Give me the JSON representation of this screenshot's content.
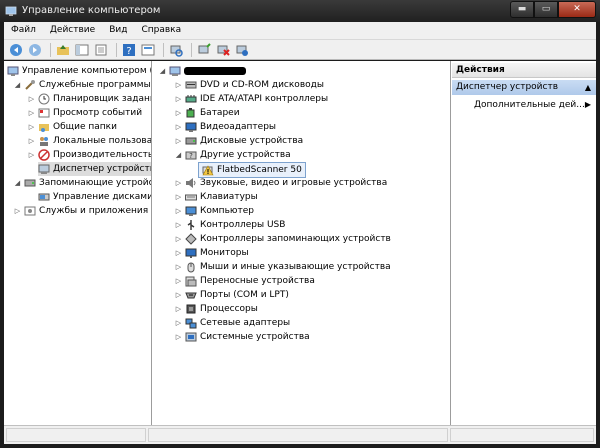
{
  "window": {
    "title": "Управление компьютером",
    "controls": {
      "minimize": "▬",
      "maximize": "▭",
      "close": "✕"
    }
  },
  "menu": [
    "Файл",
    "Действие",
    "Вид",
    "Справка"
  ],
  "toolbar_icons": [
    "back-icon",
    "forward-icon",
    "up-folder-icon",
    "show-hide-tree-icon",
    "export-list-icon",
    "help-icon",
    "properties-icon",
    "scan-hardware-icon",
    "update-driver-icon",
    "disable-device-icon",
    "uninstall-device-icon"
  ],
  "left_tree": [
    {
      "label": "Управление компьютером (л",
      "toggle": "",
      "icon": "computer-management-icon"
    },
    {
      "label": "Служебные программы",
      "toggle": "◢",
      "icon": "tools-icon"
    },
    {
      "label": "Планировщик заданий",
      "toggle": "▷",
      "icon": "clock-icon"
    },
    {
      "label": "Просмотр событий",
      "toggle": "▷",
      "icon": "event-viewer-icon"
    },
    {
      "label": "Общие папки",
      "toggle": "▷",
      "icon": "shared-folder-icon"
    },
    {
      "label": "Локальные пользовате",
      "toggle": "▷",
      "icon": "users-icon"
    },
    {
      "label": "Производительность",
      "toggle": "▷",
      "icon": "performance-icon"
    },
    {
      "label": "Диспетчер устройств",
      "toggle": "",
      "icon": "device-manager-icon"
    },
    {
      "label": "Запоминающие устройств",
      "toggle": "◢",
      "icon": "storage-icon"
    },
    {
      "label": "Управление дисками",
      "toggle": "",
      "icon": "disk-management-icon"
    },
    {
      "label": "Службы и приложения",
      "toggle": "▷",
      "icon": "services-icon"
    }
  ],
  "device_tree": {
    "root_toggle": "◢",
    "children": [
      {
        "label": "DVD и CD-ROM дисководы",
        "toggle": "▷",
        "icon": "dvd-icon"
      },
      {
        "label": "IDE ATA/ATAPI контроллеры",
        "toggle": "▷",
        "icon": "ide-controller-icon"
      },
      {
        "label": "Батареи",
        "toggle": "▷",
        "icon": "battery-icon"
      },
      {
        "label": "Видеоадаптеры",
        "toggle": "▷",
        "icon": "display-adapter-icon"
      },
      {
        "label": "Дисковые устройства",
        "toggle": "▷",
        "icon": "disk-drive-icon"
      },
      {
        "label": "Другие устройства",
        "toggle": "◢",
        "icon": "other-devices-icon"
      },
      {
        "label": "FlatbedScanner 50",
        "toggle": "",
        "icon": "warning-device-icon",
        "child": true
      },
      {
        "label": "Звуковые, видео и игровые устройства",
        "toggle": "▷",
        "icon": "sound-icon"
      },
      {
        "label": "Клавиатуры",
        "toggle": "▷",
        "icon": "keyboard-icon"
      },
      {
        "label": "Компьютер",
        "toggle": "▷",
        "icon": "computer-icon"
      },
      {
        "label": "Контроллеры USB",
        "toggle": "▷",
        "icon": "usb-icon"
      },
      {
        "label": "Контроллеры запоминающих устройств",
        "toggle": "▷",
        "icon": "storage-controller-icon"
      },
      {
        "label": "Мониторы",
        "toggle": "▷",
        "icon": "monitor-icon"
      },
      {
        "label": "Мыши и иные указывающие устройства",
        "toggle": "▷",
        "icon": "mouse-icon"
      },
      {
        "label": "Переносные устройства",
        "toggle": "▷",
        "icon": "portable-device-icon"
      },
      {
        "label": "Порты (COM и LPT)",
        "toggle": "▷",
        "icon": "port-icon"
      },
      {
        "label": "Процессоры",
        "toggle": "▷",
        "icon": "processor-icon"
      },
      {
        "label": "Сетевые адаптеры",
        "toggle": "▷",
        "icon": "network-adapter-icon"
      },
      {
        "label": "Системные устройства",
        "toggle": "▷",
        "icon": "system-device-icon"
      }
    ]
  },
  "actions": {
    "header": "Действия",
    "section": "Диспетчер устройств",
    "section_arrow": "▲",
    "item": "Дополнительные дей...",
    "item_arrow": "▶"
  },
  "colors": {
    "selection": "#dcdcdc",
    "section_bar": "#c9dcf3",
    "warning": "#f2c744"
  }
}
